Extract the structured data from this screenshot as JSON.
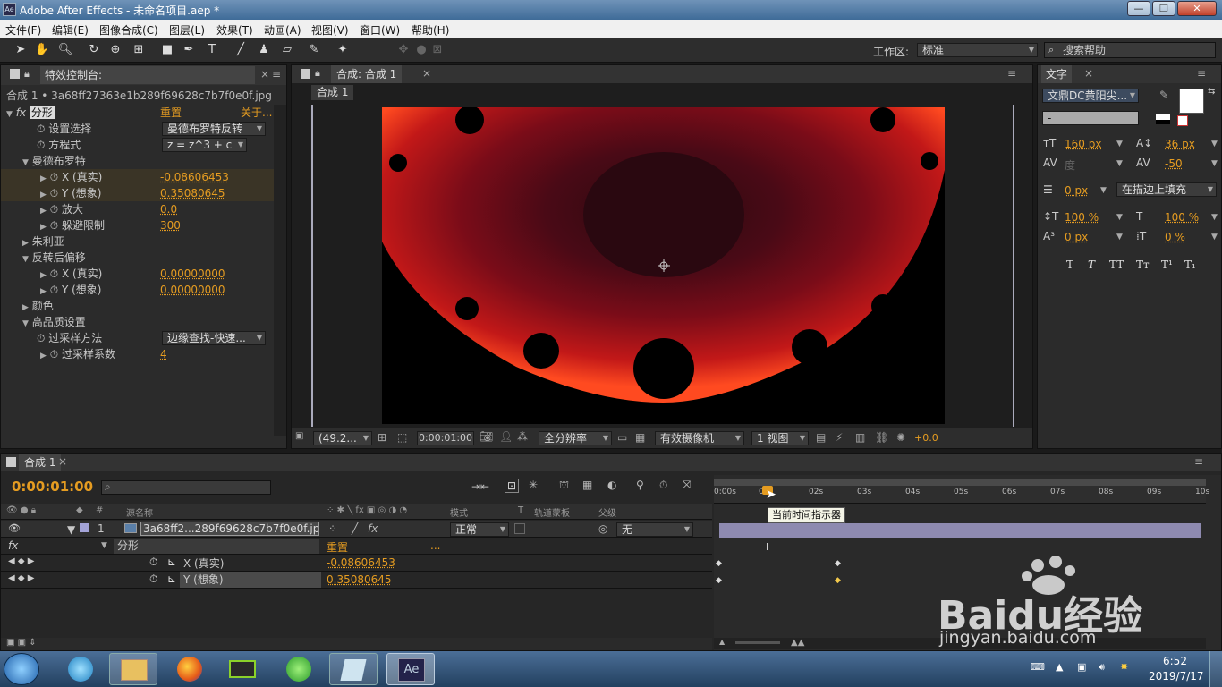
{
  "window": {
    "title": "Adobe After Effects - 未命名项目.aep *",
    "app_icon": "Ae"
  },
  "menu": [
    "文件(F)",
    "编辑(E)",
    "图像合成(C)",
    "图层(L)",
    "效果(T)",
    "动画(A)",
    "视图(V)",
    "窗口(W)",
    "帮助(H)"
  ],
  "toolbar": {
    "workspace_label": "工作区:",
    "workspace_value": "标准",
    "search_placeholder": "搜索帮助"
  },
  "effects_panel": {
    "tab": "特效控制台: 3a68ff27363e1b289f69628c7b7f",
    "layer_path": "合成 1 • 3a68ff27363e1b289f69628c7b7f0e0f.jpg",
    "effect_name": "分形",
    "reset": "重置",
    "about": "关于...",
    "rows": {
      "setting": "设置选择",
      "setting_val": "曼德布罗特反转",
      "equation": "方程式",
      "equation_val": "z = z^3 + c",
      "mandel": "曼德布罗特",
      "x_real": "X (真实)",
      "x_real_val": "-0.08606453",
      "y_imag": "Y (想象)",
      "y_imag_val": "0.35080645",
      "magnify": "放大",
      "magnify_val": "0.0",
      "escape": "躲避限制",
      "escape_val": "300",
      "julia": "朱利亚",
      "post_offset": "反转后偏移",
      "px_real": "X (真实)",
      "px_real_val": "0.00000000",
      "py_imag": "Y (想象)",
      "py_imag_val": "0.00000000",
      "color": "颜色",
      "hq": "高品质设置",
      "oversample_method": "过采样方法",
      "oversample_method_val": "边缘查找-快速...",
      "oversample_factor": "过采样系数",
      "oversample_factor_val": "4"
    }
  },
  "comp_panel": {
    "tab": "合成: 合成 1",
    "subtab": "合成 1",
    "zoom": "(49.2...",
    "time": "0:00:01:00",
    "resolution": "全分辨率",
    "camera": "有效摄像机",
    "views": "1 视图",
    "exposure": "+0.0"
  },
  "text_panel": {
    "tab": "文字",
    "font": "文鼎DC黄阳尖...",
    "style": "-",
    "size": "160 px",
    "leading": "36 px",
    "kerning": "度",
    "tracking": "-50",
    "stroke": "0 px",
    "stroke_mode": "在描边上填充",
    "vscale": "100 %",
    "hscale": "100 %",
    "baseline": "0 px",
    "tsume": "0 %",
    "styles": [
      "T",
      "T",
      "TT",
      "Tт",
      "T¹",
      "T₁"
    ]
  },
  "timeline": {
    "tab": "合成 1",
    "current_time": "0:00:01:00",
    "columns": {
      "source": "源名称",
      "mode": "模式",
      "t": "T",
      "track": "轨道蒙板",
      "parent": "父级"
    },
    "layer": {
      "index": "1",
      "name": "3a68ff2...289f69628c7b7f0e0f.jpg",
      "mode": "正常",
      "parent": "无"
    },
    "effect": {
      "name": "分形",
      "reset": "重置",
      "dots": "..."
    },
    "props": [
      {
        "name": "X (真实)",
        "value": "-0.08606453"
      },
      {
        "name": "Y (想象)",
        "value": "0.35080645"
      }
    ],
    "ruler": [
      "0:00s",
      "01s",
      "02s",
      "03s",
      "04s",
      "05s",
      "06s",
      "07s",
      "08s",
      "09s",
      "10s"
    ],
    "tooltip": "当前时间指示器"
  },
  "watermark": {
    "line1": "Baidu经验",
    "line2": "jingyan.baidu.com"
  },
  "taskbar": {
    "time": "6:52",
    "date": "2019/7/17"
  },
  "colors": {
    "accent": "#e59c21",
    "panel": "#2b2b2b",
    "bg": "#1a1a1a",
    "layerbar": "#8e8ab0",
    "playhead": "#d32a2a"
  }
}
